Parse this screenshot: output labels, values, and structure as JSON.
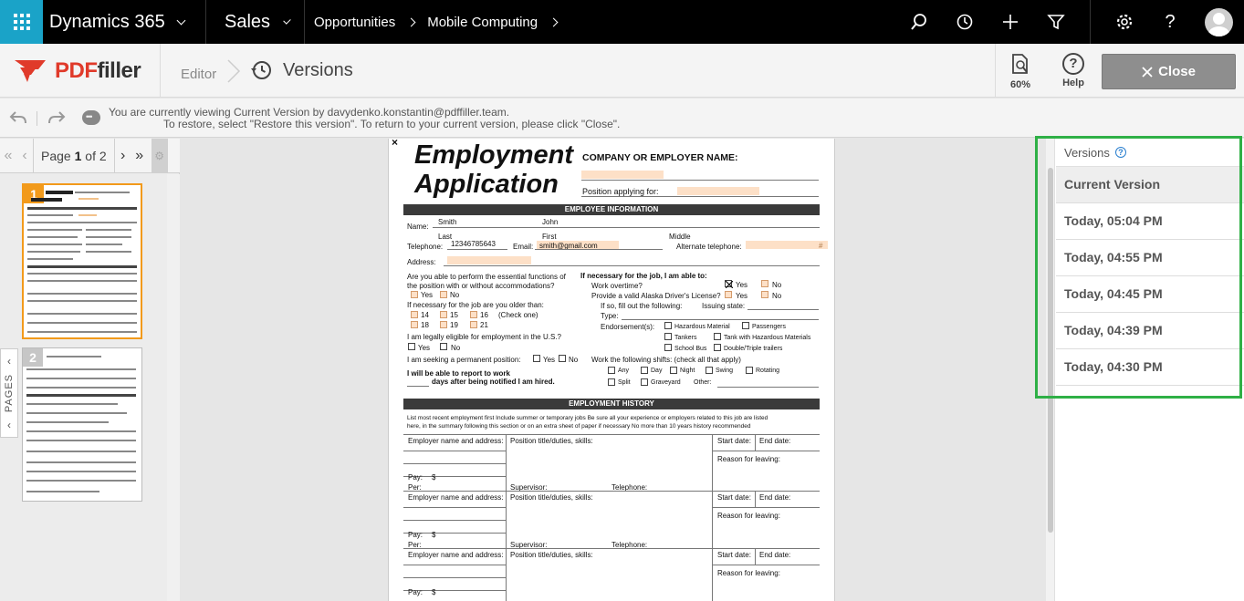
{
  "topbar": {
    "app_name": "Dynamics 365",
    "area": "Sales",
    "breadcrumb": [
      "Opportunities",
      "Mobile Computing"
    ]
  },
  "pdffiller": {
    "logo_pdf": "PDF",
    "logo_filler": "filler",
    "editor_label": "Editor",
    "versions_label": "Versions",
    "zoom_label": "60%",
    "help_label": "Help",
    "close_label": "Close"
  },
  "infobar": {
    "line1": "You are currently viewing Current Version  by davydenko.konstantin@pdffiller.team.",
    "line2": "To restore, select \"Restore this version\". To return to your current version, please click \"Close\"."
  },
  "pager": {
    "page_word": "Page",
    "current": "1",
    "of_text": "of 2"
  },
  "thumbnails": [
    {
      "number": "1"
    },
    {
      "number": "2"
    }
  ],
  "pages_tab": "PAGES",
  "document": {
    "title1": "Employment",
    "title2": "Application",
    "company_label": "COMPANY OR EMPLOYER NAME:",
    "position_label": "Position applying for:",
    "employee_info": "EMPLOYEE INFORMATION",
    "name_label": "Name:",
    "last_value": "Smith",
    "first_value": "John",
    "last_label": "Last",
    "first_label": "First",
    "middle_label": "Middle",
    "telephone_label": "Telephone:",
    "telephone_value": "12346785643",
    "email_label": "Email:",
    "email_value": "smith@gmail.com",
    "alt_tel_label": "Alternate telephone:",
    "hash": "#",
    "address_label": "Address:",
    "q_essential": "Are you able to perform the essential functions of",
    "q_essential2": "the position with or without accommodations?",
    "yes": "Yes",
    "no": "No",
    "q_older": "If necessary for the job are you older than:",
    "ages": [
      "14",
      "15",
      "16",
      "18",
      "19",
      "21"
    ],
    "check_one": "(Check one)",
    "q_eligible": "I am legally eligible for employment in the U.S.?",
    "q_permanent": "I am seeking a permanent position:",
    "q_report1": "I will be able to report to work",
    "q_report2": "days after being notified I am hired.",
    "able_label": "If necessary for the job, I am able to:",
    "work_overtime": "Work overtime?",
    "alaska": "Provide a valid Alaska Driver's License?",
    "if_so": "If so, fill out the following:",
    "issuing": "Issuing state:",
    "type_label": "Type:",
    "endorsements": "Endorsement(s):",
    "end_items": [
      "Hazardous Material",
      "Passengers",
      "Tankers",
      "Tank with Hazardous Materials",
      "School Bus",
      "Double/Triple trailers"
    ],
    "shifts_label": "Work the following shifts: (check all that apply)",
    "shifts": [
      "Any",
      "Day",
      "Night",
      "Swing",
      "Rotating",
      "Split",
      "Graveyard"
    ],
    "other_label": "Other:",
    "history_header": "EMPLOYMENT HISTORY",
    "history_note1": "List most recent employment first  Include summer or temporary jobs  Be sure all your experience or employers related to this job are listed",
    "history_note2": "here, in the summary following this section or on an extra sheet of paper if necessary  No more than 10 years history recommended",
    "employer_label": "Employer name and address:",
    "position_duties": "Position title/duties, skills:",
    "start_date": "Start date:",
    "end_date": "End date:",
    "reason": "Reason for leaving:",
    "pay": "Pay:",
    "dollar": "$",
    "per": "Per:",
    "supervisor": "Supervisor:",
    "telephone2": "Telephone:",
    "close_x": "×"
  },
  "versions_panel": {
    "header": "Versions",
    "items": [
      {
        "label": "Current Version",
        "selected": true
      },
      {
        "label": "Today, 05:04 PM",
        "selected": false
      },
      {
        "label": "Today, 04:55 PM",
        "selected": false
      },
      {
        "label": "Today, 04:45 PM",
        "selected": false
      },
      {
        "label": "Today, 04:39 PM",
        "selected": false
      },
      {
        "label": "Today, 04:30 PM",
        "selected": false
      }
    ]
  },
  "colors": {
    "accent": "#1aa3c8",
    "pdffiller_red": "#e03a2a",
    "highlight_frame": "#2fb046",
    "thumb_active": "#f29a1b"
  }
}
